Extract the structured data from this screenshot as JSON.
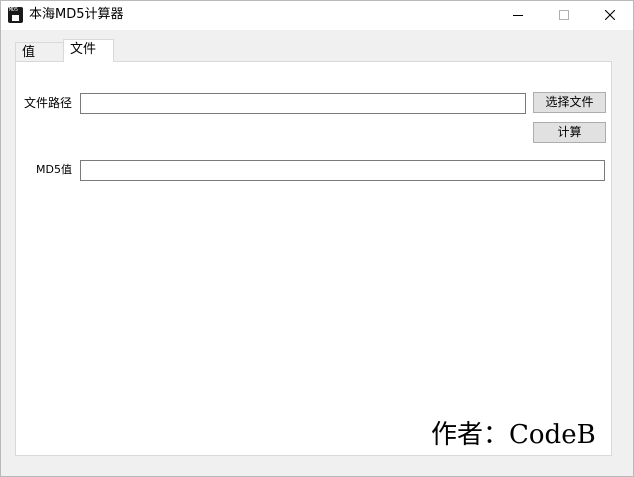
{
  "window": {
    "title": "本海MD5计算器",
    "icon": "md5-app-icon",
    "icon_text": "MD5",
    "controls": [
      "minimize-icon",
      "maximize-icon",
      "close-icon"
    ]
  },
  "tabs": [
    {
      "label": "值",
      "active": false
    },
    {
      "label": "文件",
      "active": true
    }
  ],
  "file_tab": {
    "path_label": "文件路径",
    "path_value": "",
    "select_button": "选择文件",
    "calc_button": "计算",
    "md5_label": "MD5值",
    "md5_value": ""
  },
  "footer": {
    "author": "作者：CodeB"
  },
  "colors": {
    "window_bg": "#f0f0f0",
    "panel_bg": "#ffffff",
    "button_bg": "#e1e1e1",
    "button_border": "#adadad"
  }
}
